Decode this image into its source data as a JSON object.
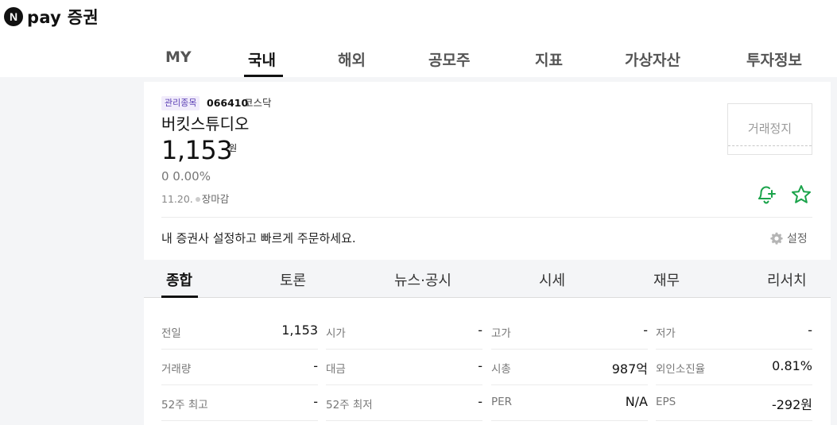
{
  "brand": {
    "badge": "N",
    "name": "pay 증권"
  },
  "top_nav": {
    "tabs": [
      {
        "label": "MY"
      },
      {
        "label": "국내"
      },
      {
        "label": "해외"
      },
      {
        "label": "공모주"
      },
      {
        "label": "지표"
      },
      {
        "label": "가상자산"
      },
      {
        "label": "투자정보"
      }
    ],
    "active": "국내"
  },
  "stock": {
    "badge": "관리종목",
    "code": "066410",
    "market": "코스닥",
    "name": "버킷스튜디오",
    "price": "1,153",
    "price_unit": "원",
    "change": "0  0.00%",
    "date": "11.20.",
    "status": "장마감",
    "halt_label": "거래정지"
  },
  "icons": {
    "alert": "bell-plus-icon",
    "favorite": "star-icon",
    "settings": "gear-icon"
  },
  "colors": {
    "accent_green": "#1aa34a",
    "badge_purple": "#5b3fb5",
    "badge_bg": "#f1ecfb"
  },
  "broker": {
    "message": "내 증권사 설정하고 빠르게 주문하세요.",
    "settings_label": "설정"
  },
  "sub_tabs": {
    "tabs": [
      {
        "label": "종합"
      },
      {
        "label": "토론"
      },
      {
        "label": "뉴스·공시"
      },
      {
        "label": "시세"
      },
      {
        "label": "재무"
      },
      {
        "label": "리서치"
      }
    ],
    "active": "종합"
  },
  "summary": [
    [
      {
        "label": "전일",
        "value": "1,153",
        "unit": ""
      },
      {
        "label": "시가",
        "value": "-",
        "unit": ""
      },
      {
        "label": "고가",
        "value": "-",
        "unit": ""
      },
      {
        "label": "저가",
        "value": "-",
        "unit": ""
      }
    ],
    [
      {
        "label": "거래량",
        "value": "-",
        "unit": ""
      },
      {
        "label": "대금",
        "value": "-",
        "unit": ""
      },
      {
        "label": "시총",
        "value": "987",
        "unit": "억"
      },
      {
        "label": "외인소진율",
        "value": "0.81%",
        "unit": ""
      }
    ],
    [
      {
        "label": "52주 최고",
        "value": "-",
        "unit": ""
      },
      {
        "label": "52주 최저",
        "value": "-",
        "unit": ""
      },
      {
        "label": "PER",
        "value": "N/A",
        "unit": ""
      },
      {
        "label": "EPS",
        "value": "-292",
        "unit": "원"
      }
    ]
  ]
}
